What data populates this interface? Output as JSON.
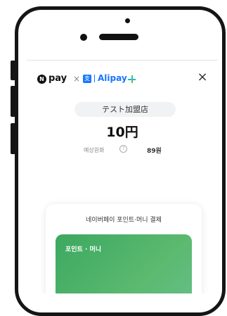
{
  "header": {
    "npay_mark": "N",
    "npay_word": "pay",
    "separator": "×",
    "alipay_mark": "支",
    "alipay_word": "Alipay",
    "close_glyph": "×",
    "icons": [
      "naverpay-logo-icon",
      "alipay-logo-icon",
      "alipay-plus-icon",
      "close-icon"
    ]
  },
  "payment": {
    "merchant": "テスト加盟店",
    "amount": "10円",
    "estimated_krw_label": "예상원화",
    "info_glyph": "?",
    "estimated_krw_value": "89원"
  },
  "method_card": {
    "title": "네이버페이 포인트·머니 결제",
    "card_label": "포인트 · 머니"
  },
  "colors": {
    "alipay_blue": "#1677ff",
    "card_green": "#4fb46a",
    "frame": "#151515"
  }
}
